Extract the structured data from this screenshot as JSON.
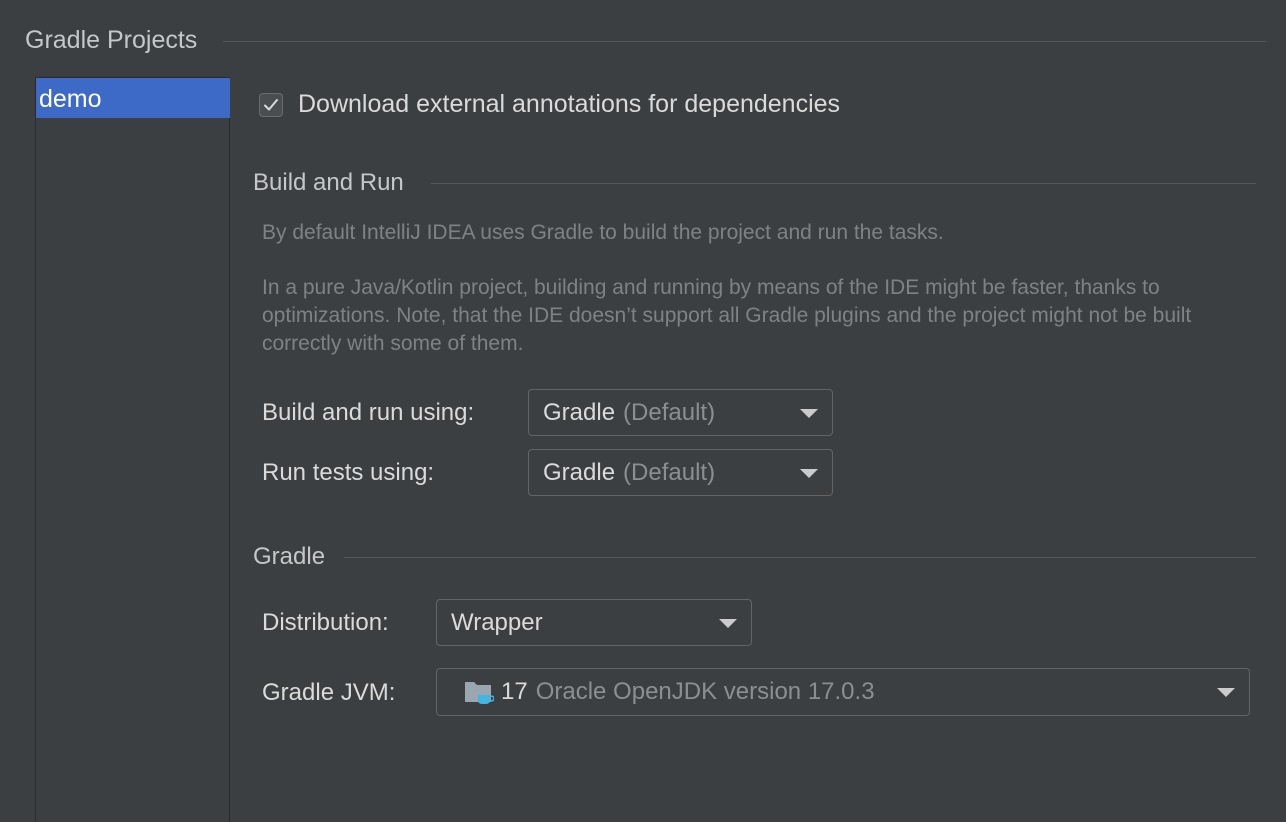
{
  "page_title": "Gradle Projects",
  "projects": [
    {
      "name": "demo",
      "selected": true
    }
  ],
  "download_annotations": {
    "label": "Download external annotations for dependencies",
    "checked": true
  },
  "build_and_run": {
    "title": "Build and Run",
    "description_1": "By default IntelliJ IDEA uses Gradle to build the project and run the tasks.",
    "description_2": "In a pure Java/Kotlin project, building and running by means of the IDE might be faster, thanks to optimizations. Note, that the IDE doesn’t support all Gradle plugins and the project might not be built correctly with some of them.",
    "build_label": "Build and run using:",
    "build_value": "Gradle",
    "build_suffix": "(Default)",
    "tests_label": "Run tests using:",
    "tests_value": "Gradle",
    "tests_suffix": "(Default)"
  },
  "gradle": {
    "title": "Gradle",
    "distribution_label": "Distribution:",
    "distribution_value": "Wrapper",
    "jvm_label": "Gradle JVM:",
    "jvm_version": "17",
    "jvm_detail": "Oracle OpenJDK version 17.0.3",
    "jvm_icon": "jdk-folder-icon"
  },
  "colors": {
    "background": "#3c3f41",
    "selection": "#3d6ac6",
    "muted_text": "#7f8285"
  }
}
